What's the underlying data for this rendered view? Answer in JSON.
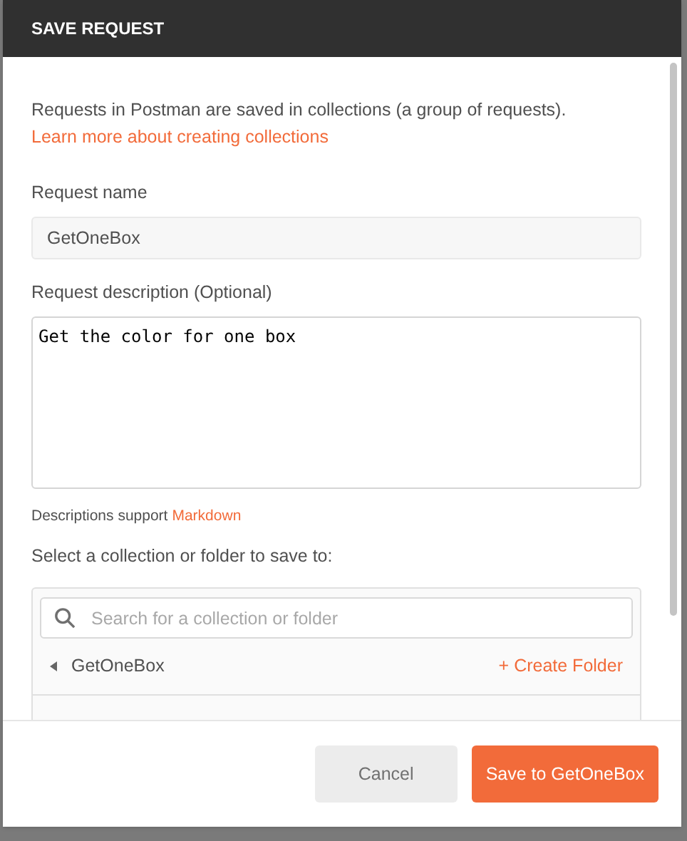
{
  "dialog": {
    "title": "SAVE REQUEST",
    "intro": "Requests in Postman are saved in collections (a group of requests).",
    "learn_link": "Learn more about creating collections",
    "name_label": "Request name",
    "name_value": "GetOneBox",
    "description_label": "Request description (Optional)",
    "description_value": "Get the color for one box",
    "markdown_note": "Descriptions support",
    "markdown_link": "Markdown",
    "collection_label": "Select a collection or folder to save to:",
    "search": {
      "placeholder": "Search for a collection or folder"
    },
    "collection": {
      "name": "GetOneBox",
      "expanded": false,
      "action": "+ Create Folder"
    },
    "buttons": [
      {
        "label": "Cancel",
        "kind": "secondary"
      },
      {
        "label": "Save to GetOneBox",
        "kind": "primary"
      }
    ]
  }
}
